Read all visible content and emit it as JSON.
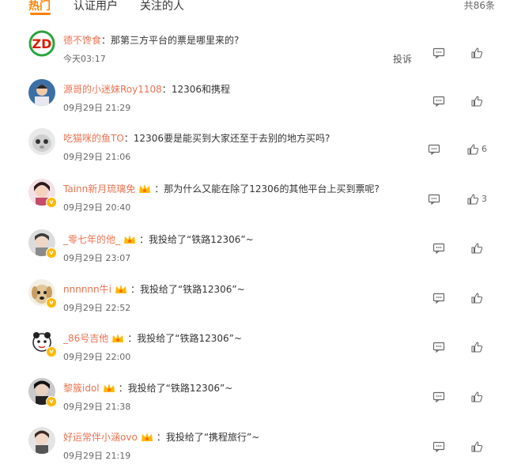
{
  "tabs": [
    "热门",
    "认证用户",
    "关注的人"
  ],
  "total": "共86条",
  "report_label": "投诉",
  "comments": [
    {
      "user": "德不馋食",
      "text": "那第三方平台的票是哪里来的?",
      "time": "今天03:17",
      "likes": ""
    },
    {
      "user": "源哥的小迷妹Roy1108",
      "text": "12306和携程",
      "time": "09月29日 21:29",
      "likes": ""
    },
    {
      "user": "吃猫咪的鱼TO",
      "text": "12306要是能买到大家还至于去别的地方买吗?",
      "time": "09月29日 21:06",
      "likes": "6"
    },
    {
      "user": "Tainn新月琉璃免",
      "text": "那为什么又能在除了12306的其他平台上买到票呢?",
      "time": "09月29日 20:40",
      "likes": "3"
    },
    {
      "user": "_零七年的他_",
      "text": "我投给了“铁路12306”~",
      "time": "09月29日 23:07",
      "likes": ""
    },
    {
      "user": "nnnnnn牛i",
      "text": "我投给了“铁路12306”~",
      "time": "09月29日 22:52",
      "likes": ""
    },
    {
      "user": "_86号吉他",
      "text": "我投给了“铁路12306”~",
      "time": "09月29日 22:00",
      "likes": ""
    },
    {
      "user": "黎簇idol",
      "text": "我投给了“铁路12306”~",
      "time": "09月29日 21:38",
      "likes": ""
    },
    {
      "user": "好运常伴小涵ovo",
      "text": "我投给了“携程旅行”~",
      "time": "09月29日 21:19",
      "likes": ""
    }
  ],
  "colors": {
    "accent": "#ff8200",
    "username": "#eb7350",
    "vip": "#ffb800"
  },
  "icons": {
    "reply": "comment-icon",
    "like": "thumbs-up-icon"
  }
}
